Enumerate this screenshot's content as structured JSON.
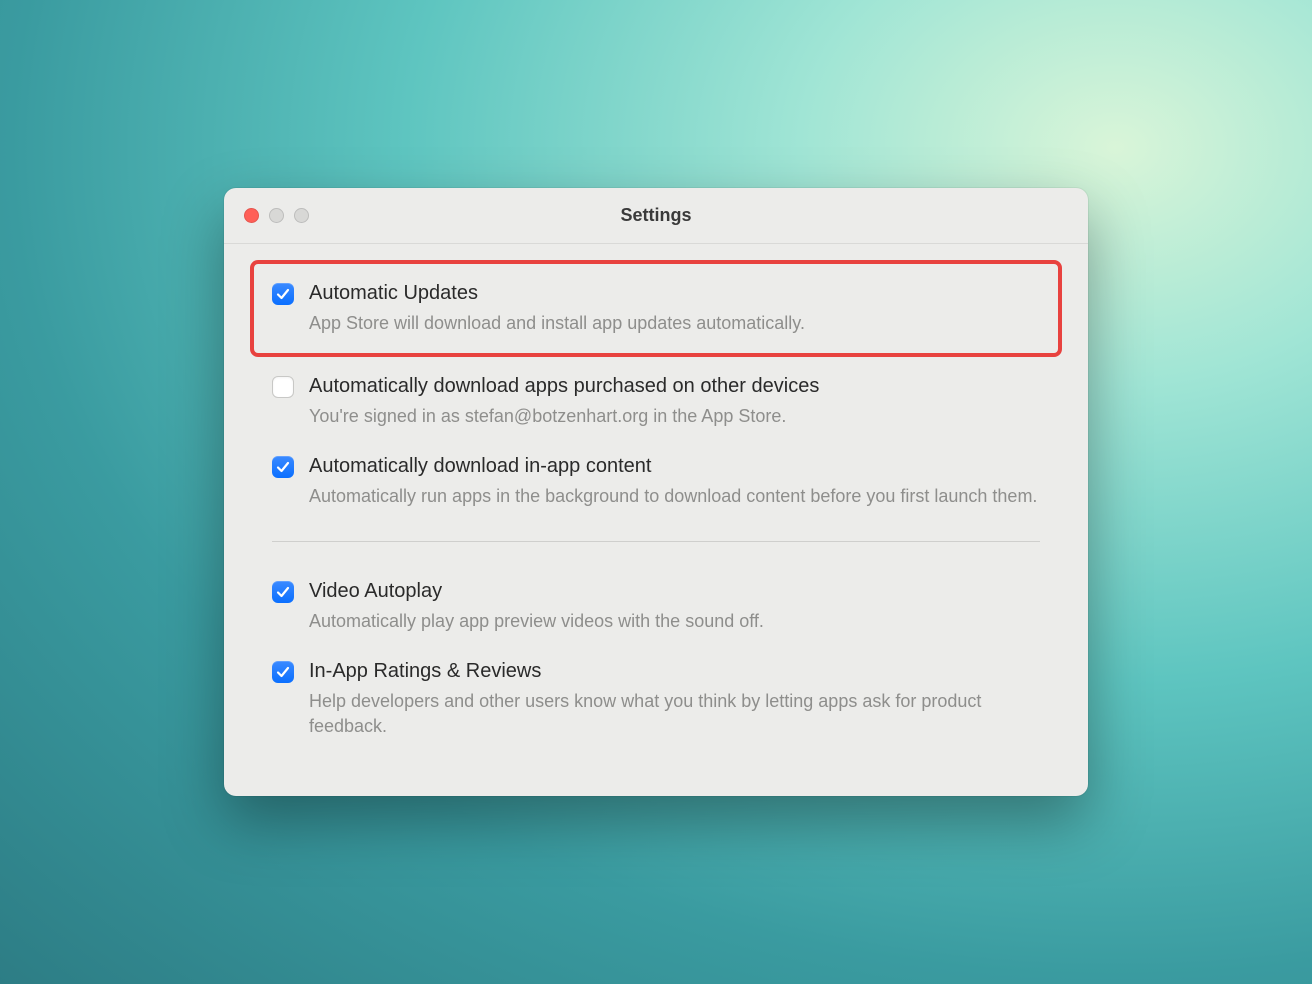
{
  "window": {
    "title": "Settings"
  },
  "settings": [
    {
      "title": "Automatic Updates",
      "description": "App Store will download and install app updates automatically.",
      "checked": true,
      "highlighted": true
    },
    {
      "title": "Automatically download apps purchased on other devices",
      "description": "You're signed in as stefan@botzenhart.org in the App Store.",
      "checked": false,
      "highlighted": false
    },
    {
      "title": "Automatically download in-app content",
      "description": "Automatically run apps in the background to download content before you first launch them.",
      "checked": true,
      "highlighted": false
    },
    {
      "title": "Video Autoplay",
      "description": "Automatically play app preview videos with the sound off.",
      "checked": true,
      "highlighted": false
    },
    {
      "title": "In-App Ratings & Reviews",
      "description": "Help developers and other users know what you think by letting apps ask for product feedback.",
      "checked": true,
      "highlighted": false
    }
  ]
}
